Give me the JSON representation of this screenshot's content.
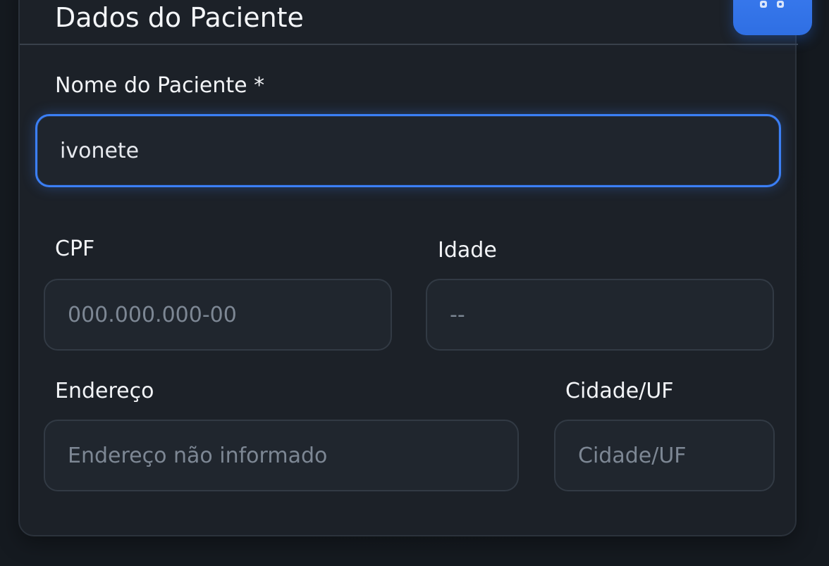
{
  "card": {
    "title": "Dados do Paciente"
  },
  "fields": {
    "name": {
      "label": "Nome do Paciente *",
      "value": "ivonete",
      "placeholder": ""
    },
    "cpf": {
      "label": "CPF",
      "value": "",
      "placeholder": "000.000.000-00"
    },
    "age": {
      "label": "Idade",
      "value": "",
      "placeholder": "--"
    },
    "address": {
      "label": "Endereço",
      "value": "",
      "placeholder": "Endereço não informado"
    },
    "city": {
      "label": "Cidade/UF",
      "value": "",
      "placeholder": "Cidade/UF"
    }
  },
  "colors": {
    "accent": "#3b7ff5",
    "background": "#151a20",
    "card": "#1c2128"
  },
  "icons": {
    "corner_button": "grid-icon"
  }
}
